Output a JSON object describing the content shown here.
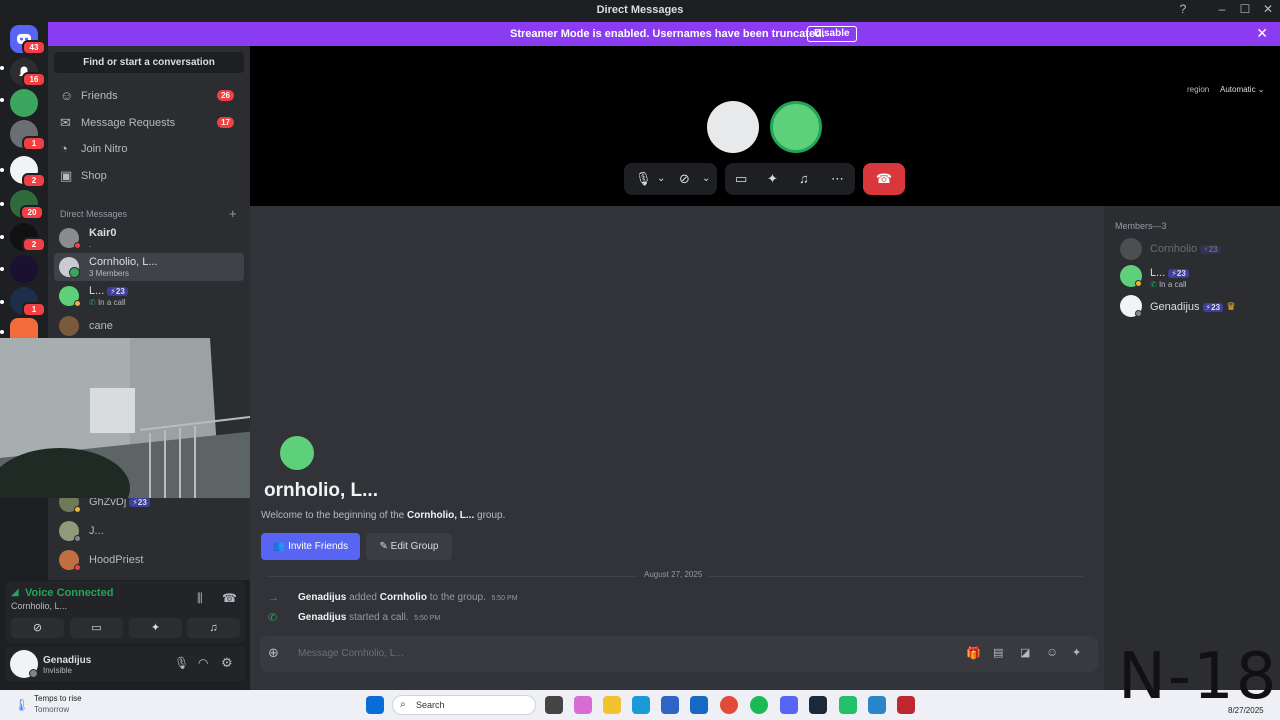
{
  "window": {
    "title": "Direct Messages",
    "help_icon": "help-icon"
  },
  "banner": {
    "message": "Streamer Mode is enabled. Usernames have been truncated.",
    "button": "Disable"
  },
  "rail": {
    "badges": [
      "43",
      "16",
      "1",
      "2",
      "20",
      "2",
      "1"
    ]
  },
  "sidebar": {
    "search_placeholder": "Find or start a conversation",
    "nav": [
      {
        "label": "Friends",
        "count": "26"
      },
      {
        "label": "Message Requests",
        "count": "17"
      },
      {
        "label": "Join Nitro"
      },
      {
        "label": "Shop"
      }
    ],
    "dm_header": "Direct Messages",
    "dms": [
      {
        "name": "Kair0",
        "sub": "."
      },
      {
        "name": "Cornholio, L...",
        "sub": "3 Members"
      },
      {
        "name": "L...",
        "tag": "⚡23",
        "sub": "In a call"
      },
      {
        "name": "cane"
      },
      {
        "name": "GhZvDj",
        "tag": "⚡23"
      },
      {
        "name": "J..."
      },
      {
        "name": "HoodPriest"
      }
    ]
  },
  "voice": {
    "status": "Voice Connected",
    "channel": "Cornholio, L..."
  },
  "user": {
    "name": "Genadijus",
    "status": "Invisible"
  },
  "call": {
    "region_label": "region",
    "region_value": "Automatic"
  },
  "chat": {
    "title": "ornholio, L...",
    "welcome_prefix": "Welcome to the beginning of the ",
    "welcome_group": "Cornholio, L...",
    "welcome_suffix": " group.",
    "invite_button": "Invite Friends",
    "edit_button": "Edit Group",
    "date_divider": "August 27, 2025",
    "events": [
      {
        "actor": "Genadijus",
        "action": " added ",
        "target": "Cornholio",
        "tail": " to the group.",
        "time": "5:50 PM"
      },
      {
        "actor": "Genadijus",
        "action": " started a call.",
        "target": "",
        "tail": "",
        "time": "5:50 PM"
      }
    ],
    "composer_placeholder": "Message Cornholio, L..."
  },
  "members": {
    "header": "Members—3",
    "list": [
      {
        "name": "Cornholio",
        "tag": "⚡23"
      },
      {
        "name": "L...",
        "tag": "⚡23",
        "sub": "In a call"
      },
      {
        "name": "Genadijus",
        "tag": "⚡23"
      }
    ]
  },
  "taskbar": {
    "weather_title": "Temps to rise",
    "weather_sub": "Tomorrow",
    "search_placeholder": "Search",
    "date": "8/27/2025"
  },
  "watermark": "N-18",
  "colors": {
    "accent": "#5865f2",
    "banner": "#8b3cf0",
    "danger": "#da373c",
    "online": "#23a559"
  }
}
